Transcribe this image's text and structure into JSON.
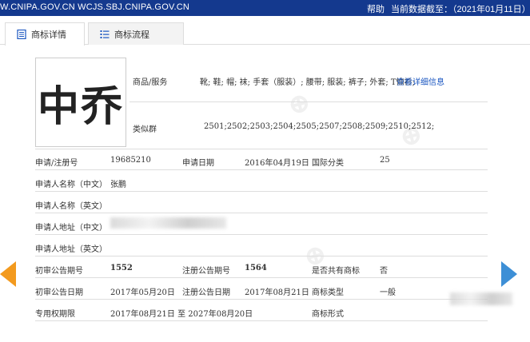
{
  "topbar": {
    "url": "W.CNIPA.GOV.CN  WCJS.SBJ.CNIPA.GOV.CN",
    "help": "帮助",
    "deadline": "当前数据截至：（2021年01月11日）"
  },
  "tabs": [
    {
      "label": "商标详情"
    },
    {
      "label": "商标流程"
    }
  ],
  "logo": {
    "text": "中乔"
  },
  "goods": {
    "label": "商品/服务",
    "value": "靴; 鞋; 帽; 袜; 手套（服装）; 腰带; 服装; 裤子; 外套; T恤衫;",
    "link": "查看详细信息"
  },
  "similar": {
    "label": "类似群",
    "value": "2501;2502;2503;2504;2505;2507;2508;2509;2510;2512;"
  },
  "rows": {
    "reg_no_label": "申请/注册号",
    "reg_no": "19685210",
    "apply_date_label": "申请日期",
    "apply_date": "2016年04月19日",
    "intl_class_label": "国际分类",
    "intl_class": "25",
    "applicant_cn_label": "申请人名称（中文）",
    "applicant_cn": "张鹏",
    "applicant_en_label": "申请人名称（英文）",
    "addr_cn_label": "申请人地址（中文）",
    "addr_en_label": "申请人地址（英文）",
    "prelim_no_label": "初审公告期号",
    "prelim_no": "1552",
    "reg_pub_no_label": "注册公告期号",
    "reg_pub_no": "1564",
    "shared_label": "是否共有商标",
    "shared": "否",
    "prelim_date_label": "初审公告日期",
    "prelim_date": "2017年05月20日",
    "reg_pub_date_label": "注册公告日期",
    "reg_pub_date": "2017年08月21日",
    "type_label": "商标类型",
    "type": "一般",
    "exclusive_label": "专用权期限",
    "exclusive": "2017年08月21日 至 2027年08月20日",
    "form_label": "商标形式"
  }
}
